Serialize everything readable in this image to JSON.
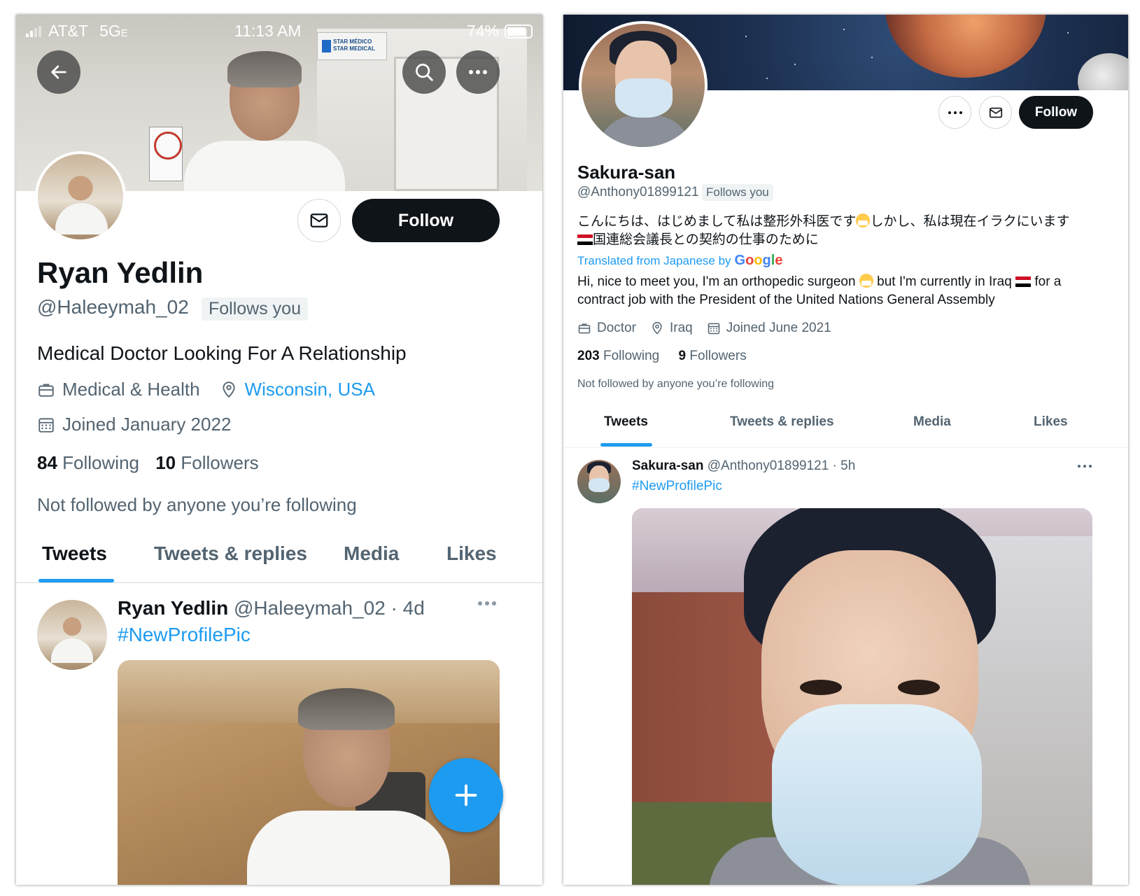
{
  "left": {
    "status": {
      "carrier": "AT&T",
      "network": "5G",
      "network_suffix": "E",
      "time": "11:13 AM",
      "battery": "74%"
    },
    "banner_sign": {
      "line1": "STAR MÉDICO",
      "line2": "STAR MEDICAL"
    },
    "follow_label": "Follow",
    "profile": {
      "name": "Ryan Yedlin",
      "handle": "@Haleeymah_02",
      "follows_you": "Follows you",
      "bio": "Medical Doctor Looking For A Relationship",
      "category": "Medical & Health",
      "location": "Wisconsin, USA",
      "joined": "Joined January 2022",
      "following_count": "84",
      "following_label": "Following",
      "followers_count": "10",
      "followers_label": "Followers",
      "not_followed": "Not followed by anyone you’re following"
    },
    "tabs": [
      "Tweets",
      "Tweets & replies",
      "Media",
      "Likes"
    ],
    "tweet": {
      "name": "Ryan Yedlin",
      "meta": "@Haleeymah_02 · 4d",
      "hashtag": "#NewProfilePic"
    }
  },
  "right": {
    "follow_label": "Follow",
    "profile": {
      "name": "Sakura-san",
      "handle": "@Anthony01899121",
      "follows_you": "Follows you",
      "bio_jp_1": "こんにちは、はじめまして私は整形外科医です",
      "bio_jp_2": "しかし、私は現在イラクにいます",
      "bio_jp_3": "国連総会議長との契約の仕事のために",
      "translated": "Translated from Japanese by",
      "google": [
        "G",
        "o",
        "o",
        "g",
        "l",
        "e"
      ],
      "google_colors": [
        "#4285F4",
        "#EA4335",
        "#FBBC05",
        "#4285F4",
        "#34A853",
        "#EA4335"
      ],
      "bio_en_1": "Hi, nice to meet you, I'm an orthopedic surgeon",
      "bio_en_2": "but I'm currently in Iraq",
      "bio_en_3": "for a contract job with the President of the United Nations General Assembly",
      "category": "Doctor",
      "location": "Iraq",
      "joined": "Joined June 2021",
      "following_count": "203",
      "following_label": "Following",
      "followers_count": "9",
      "followers_label": "Followers",
      "not_followed": "Not followed by anyone you’re following"
    },
    "tabs": [
      "Tweets",
      "Tweets & replies",
      "Media",
      "Likes"
    ],
    "tweet": {
      "name": "Sakura-san",
      "meta": "@Anthony01899121 · 5h",
      "hashtag": "#NewProfilePic"
    }
  },
  "colors": {
    "accent": "#1d9bf0",
    "text": "#0f1419",
    "secondary": "#536471",
    "button": "#0f1419"
  }
}
